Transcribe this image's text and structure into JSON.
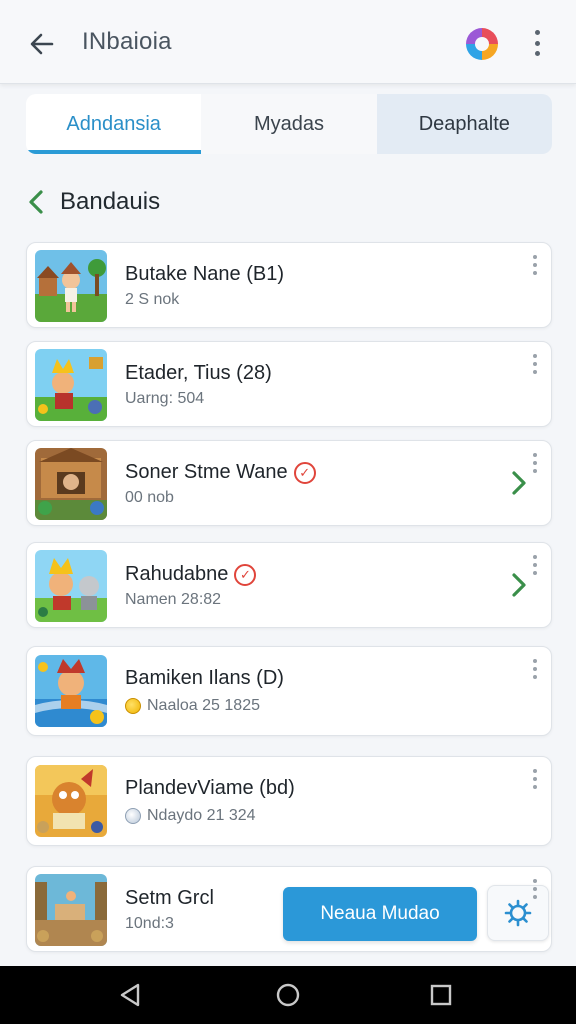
{
  "app_bar": {
    "title": "INbaioia",
    "back_icon": "arrow-left-icon",
    "logo_icon": "app-logo-icon",
    "more_icon": "more-vertical-icon"
  },
  "tabs": [
    {
      "label": "Adndansia",
      "active": true
    },
    {
      "label": "Myadas",
      "active": false
    },
    {
      "label": "Deaphalte",
      "active": false
    }
  ],
  "section": {
    "title": "Bandauis",
    "back_icon": "chevron-left-icon"
  },
  "games": [
    {
      "name": "Butake Nane (B1)",
      "sub": "2 S nok",
      "verified": false,
      "chevron": false,
      "sub_icon": ""
    },
    {
      "name": "Etader, Tius (28)",
      "sub": "Uarng: 504",
      "verified": false,
      "chevron": false,
      "sub_icon": ""
    },
    {
      "name": "Soner Stme Wane",
      "sub": "00 nob",
      "verified": true,
      "chevron": true,
      "sub_icon": ""
    },
    {
      "name": "Rahudabne",
      "sub": "Namen 28:82",
      "verified": true,
      "chevron": true,
      "sub_icon": ""
    },
    {
      "name": "Bamiken Ilans (D)",
      "sub": "Naaloa 25 1825",
      "verified": false,
      "chevron": false,
      "sub_icon": "coin-icon"
    },
    {
      "name": "PlandevViame (bd)",
      "sub": "Ndaydo 21 324",
      "verified": false,
      "chevron": false,
      "sub_icon": "gem-icon"
    },
    {
      "name": "Setm Grcl",
      "sub": "10nd:3",
      "verified": false,
      "chevron": false,
      "sub_icon": ""
    }
  ],
  "actions": {
    "primary_label": "Neaua Mudao",
    "settings_icon": "gear-icon"
  },
  "system_nav": {
    "back_icon": "triangle-back-icon",
    "home_icon": "circle-home-icon",
    "recents_icon": "square-recents-icon"
  },
  "colors": {
    "accent": "#2a9bd6",
    "verified_red": "#e0453b",
    "chevron_green": "#3a8f4a"
  }
}
